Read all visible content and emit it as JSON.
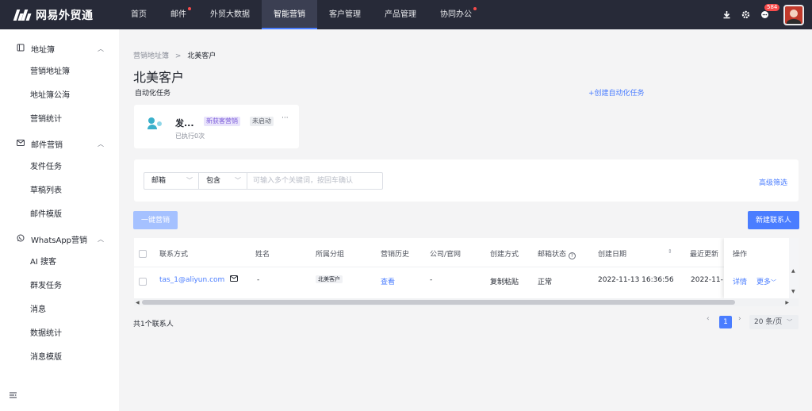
{
  "app": {
    "logo_text": "网易外贸通"
  },
  "nav": {
    "items": [
      {
        "label": "首页",
        "dot": false
      },
      {
        "label": "邮件",
        "dot": true
      },
      {
        "label": "外贸大数据",
        "dot": false
      },
      {
        "label": "智能营销",
        "dot": false,
        "active": true
      },
      {
        "label": "客户管理",
        "dot": false
      },
      {
        "label": "产品管理",
        "dot": false
      },
      {
        "label": "协同办公",
        "dot": true
      }
    ],
    "badge_count": "584",
    "icons": [
      "download-icon",
      "gear-icon",
      "message-icon"
    ]
  },
  "sidebar": {
    "groups": [
      {
        "label": "地址簿",
        "icon": "book-icon",
        "items": [
          "营销地址簿",
          "地址簿公海",
          "营销统计"
        ]
      },
      {
        "label": "邮件营销",
        "icon": "mail-icon",
        "items": [
          "发件任务",
          "草稿列表",
          "邮件模版"
        ]
      },
      {
        "label": "WhatsApp营销",
        "icon": "whatsapp-icon",
        "items": [
          "AI 搜客",
          "群发任务",
          "消息",
          "数据统计",
          "消息模版"
        ]
      }
    ]
  },
  "breadcrumb": {
    "parent": "营销地址簿",
    "separator": ">",
    "current": "北美客户"
  },
  "page": {
    "title": "北美客户",
    "auto_label": "自动化任务",
    "create_auto": "+创建自动化任务"
  },
  "task": {
    "name": "发...",
    "tag1": "新获客营销",
    "tag2": "未启动",
    "more": "···",
    "sub": "已执行0次"
  },
  "filter": {
    "field": "邮箱",
    "op": "包含",
    "placeholder": "可输入多个关键词，按回车确认",
    "advanced": "高级筛选"
  },
  "actions": {
    "bulk": "一键营销",
    "new_contact": "新建联系人"
  },
  "table": {
    "headers": [
      "联系方式",
      "姓名",
      "所属分组",
      "营销历史",
      "公司/官网",
      "创建方式",
      "邮箱状态",
      "创建日期",
      "最近更新",
      "操作"
    ],
    "row": {
      "contact": "tas_1@aliyun.com",
      "name": "-",
      "group": "北美客户",
      "history": "查看",
      "company": "-",
      "method": "复制粘贴",
      "status": "正常",
      "created": "2022-11-13 16:36:56",
      "updated": "2022-11-",
      "detail": "详情",
      "more": "更多"
    }
  },
  "footer": {
    "total": "共1个联系人",
    "page": "1",
    "page_size": "20 条/页"
  },
  "colors": {
    "accent": "#4a7dff",
    "topbar": "#272a38"
  }
}
